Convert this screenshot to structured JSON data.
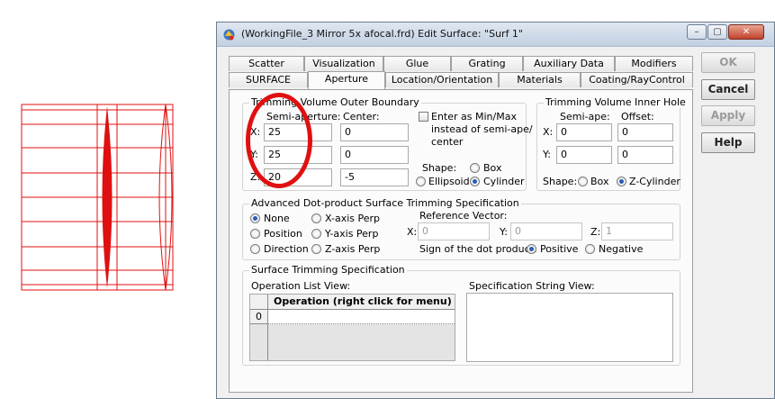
{
  "window": {
    "title": "(WorkingFile_3 Mirror 5x afocal.frd) Edit Surface: \"Surf 1\"",
    "minimize": "–",
    "maximize": "▢",
    "close": "✕"
  },
  "side_buttons": {
    "ok": "OK",
    "cancel": "Cancel",
    "apply": "Apply",
    "help": "Help"
  },
  "tabs_row1": [
    "Scatter",
    "Visualization",
    "Glue",
    "Grating",
    "Auxiliary Data",
    "Modifiers"
  ],
  "tabs_row2": [
    "SURFACE",
    "Aperture",
    "Location/Orientation",
    "Materials",
    "Coating/RayControl"
  ],
  "outer": {
    "title": "Trimming Volume Outer Boundary",
    "semi_aperture": "Semi-aperture:",
    "center": "Center:",
    "x_label": "X:",
    "y_label": "Y:",
    "z_label": "Z:",
    "x_semi": "25",
    "x_center": "0",
    "y_semi": "25",
    "y_center": "0",
    "z_semi": "20",
    "z_center": "-5",
    "enter_minmax": "Enter as Min/Max",
    "enter_minmax_2": "instead of semi-ape/",
    "enter_minmax_3": "center",
    "shape_label": "Shape:",
    "box": "Box",
    "ellipsoid": "Ellipsoid",
    "cylinder": "Cylinder"
  },
  "inner": {
    "title": "Trimming Volume Inner Hole",
    "semi_ape": "Semi-ape:",
    "offset": "Offset:",
    "x_label": "X:",
    "y_label": "Y:",
    "x_semi": "0",
    "x_offset": "0",
    "y_semi": "0",
    "y_offset": "0",
    "shape_label": "Shape:",
    "box": "Box",
    "zcyl": "Z-Cylinder"
  },
  "advanced": {
    "title": "Advanced Dot-product Surface Trimming Specification",
    "none": "None",
    "position": "Position",
    "direction": "Direction",
    "xperp": "X-axis Perp",
    "yperp": "Y-axis Perp",
    "zperp": "Z-axis Perp",
    "ref_vector": "Reference Vector:",
    "x_label": "X:",
    "y_label": "Y:",
    "z_label": "Z:",
    "x_val": "0",
    "y_val": "0",
    "z_val": "1",
    "sign_label": "Sign of the dot product:",
    "positive": "Positive",
    "negative": "Negative"
  },
  "trimming": {
    "title": "Surface Trimming Specification",
    "op_list": "Operation List View:",
    "spec_string": "Specification String View:",
    "col_header": "Operation (right click for menu)",
    "row0": "0"
  }
}
